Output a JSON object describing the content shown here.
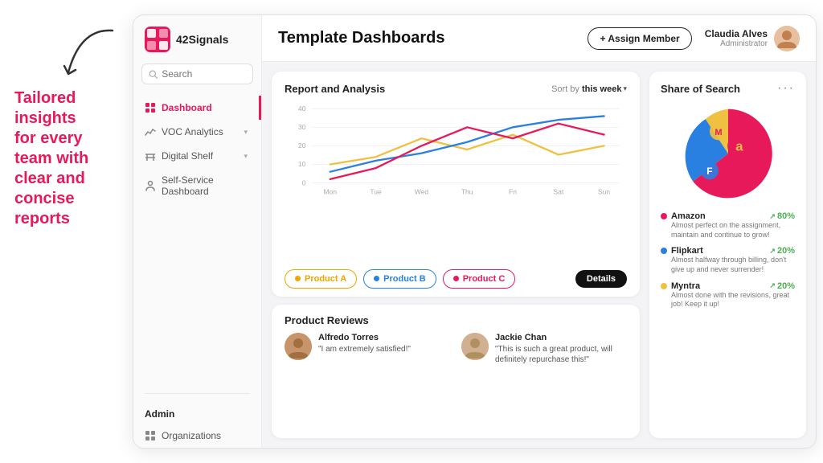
{
  "annotation": {
    "text": "Tailored\ninsights\nfor every\nteam with\nclear and\nconcise\nreports"
  },
  "sidebar": {
    "brand": "42Signals",
    "search_placeholder": "Search",
    "nav_items": [
      {
        "label": "Dashboard",
        "active": true,
        "icon": "grid"
      },
      {
        "label": "VOC Analytics",
        "active": false,
        "icon": "chart",
        "has_chevron": true
      },
      {
        "label": "Digital Shelf",
        "active": false,
        "icon": "shelf",
        "has_chevron": true
      },
      {
        "label": "Self-Service Dashboard",
        "active": false,
        "icon": "service"
      }
    ],
    "admin_label": "Admin",
    "admin_items": [
      {
        "label": "Organizations",
        "icon": "grid"
      }
    ]
  },
  "topbar": {
    "title": "Template Dashboards",
    "assign_btn": "+ Assign Member",
    "user_name": "Claudia Alves",
    "user_role": "Administrator"
  },
  "report_card": {
    "title": "Report and Analysis",
    "sort_label": "Sort by",
    "sort_value": "this week",
    "y_labels": [
      "40",
      "30",
      "20",
      "10",
      "0"
    ],
    "x_labels": [
      "Mon",
      "Tue",
      "Wed",
      "Thu",
      "Fri",
      "Sat",
      "Sun"
    ],
    "products": [
      {
        "label": "Product A",
        "color": "#f0a500"
      },
      {
        "label": "Product B",
        "color": "#2a80e1"
      },
      {
        "label": "Product C",
        "color": "#e8195a"
      }
    ],
    "details_btn": "Details"
  },
  "reviews_card": {
    "title": "Product Reviews",
    "reviews": [
      {
        "name": "Alfredo Torres",
        "quote": "\"I am extremely satisfied!\""
      },
      {
        "name": "Jackie Chan",
        "quote": "\"This is such a great product, will definitely repurchase this!\""
      }
    ]
  },
  "sos_card": {
    "title": "Share of Search",
    "legend": [
      {
        "name": "Amazon",
        "pct": "80%",
        "color": "#e8195a",
        "desc": "Almost perfect on the assignment, maintain and continue to grow!"
      },
      {
        "name": "Flipkart",
        "pct": "20%",
        "color": "#2a80e1",
        "desc": "Almost halfway through billing, don't give up and never surrender!"
      },
      {
        "name": "Myntra",
        "pct": "20%",
        "color": "#f0c040",
        "desc": "Almost done with the revisions, great job! Keep it up!"
      }
    ]
  }
}
